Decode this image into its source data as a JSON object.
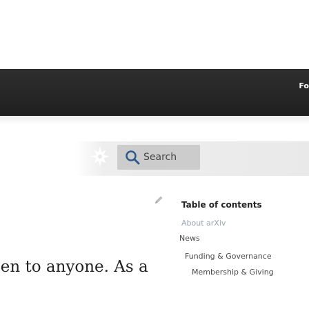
{
  "header": {
    "nav_partial_label": "Fo"
  },
  "toolbar": {
    "logo_icon": "logo-icon",
    "search": {
      "icon": "search-icon",
      "label": "Search"
    }
  },
  "content": {
    "edit_icon": "pencil-icon",
    "body_text_visible": "pen to anyone. As a"
  },
  "toc": {
    "title": "Table of contents",
    "items": [
      {
        "label": "About arXiv"
      },
      {
        "label": "News"
      },
      {
        "label": "Funding & Governance"
      },
      {
        "label": "Membership & Giving"
      }
    ]
  },
  "colors": {
    "header_bg": "#242424",
    "toolbar_bg": "#e9e9e9",
    "search_bg": "#cccccc",
    "text_dark": "#222222",
    "text_muted": "#4a4a4a",
    "toc_active": "#9aa3b5"
  }
}
